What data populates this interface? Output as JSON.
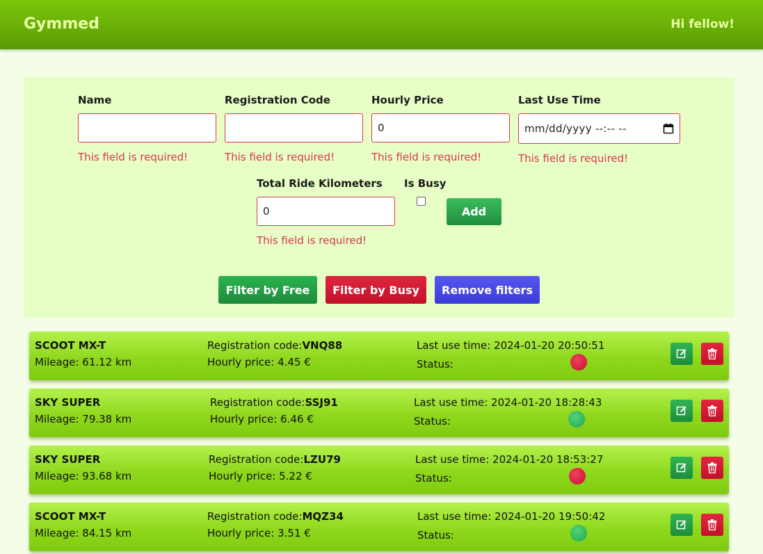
{
  "nav": {
    "brand": "Gymmed",
    "greeting": "Hi fellow!"
  },
  "form": {
    "fields": [
      {
        "label": "Name",
        "value": "",
        "error": "This field is required!"
      },
      {
        "label": "Registration Code",
        "value": "",
        "error": "This field is required!"
      },
      {
        "label": "Hourly Price",
        "value": "0",
        "error": "This field is required!"
      },
      {
        "label": "Last Use Time",
        "value": "mm/dd/yyyy --:-- --",
        "error": "This field is required!"
      },
      {
        "label": "Total Ride Kilometers",
        "value": "0",
        "error": "This field is required!"
      }
    ],
    "is_busy_label": "Is Busy",
    "is_busy_checked": false,
    "add_label": "Add"
  },
  "filters": {
    "free": "Filter by Free",
    "busy": "Filter by Busy",
    "remove": "Remove filters"
  },
  "labels": {
    "mileage_prefix": "Mileage: ",
    "reg_prefix": "Registration code:",
    "price_prefix": "Hourly price: ",
    "last_use_prefix": "Last use time: ",
    "status": "Status:"
  },
  "colors": {
    "busy": "#d51a33",
    "free": "#2cb457",
    "accent": "#7cc70a"
  },
  "scooters": [
    {
      "name": "SCOOT MX-T",
      "mileage": "61.12 km",
      "reg": "VNQ88",
      "price": "4.45 €",
      "last_use": "2024-01-20 20:50:51",
      "status": "busy"
    },
    {
      "name": "SKY SUPER",
      "mileage": "79.38 km",
      "reg": "SSJ91",
      "price": "6.46 €",
      "last_use": "2024-01-20 18:28:43",
      "status": "free"
    },
    {
      "name": "SKY SUPER",
      "mileage": "93.68 km",
      "reg": "LZU79",
      "price": "5.22 €",
      "last_use": "2024-01-20 18:53:27",
      "status": "busy"
    },
    {
      "name": "SCOOT MX-T",
      "mileage": "84.15 km",
      "reg": "MQZ34",
      "price": "3.51 €",
      "last_use": "2024-01-20 19:50:42",
      "status": "free"
    }
  ]
}
